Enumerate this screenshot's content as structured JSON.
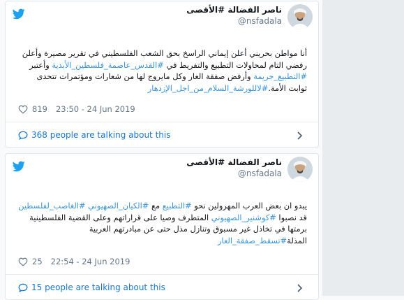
{
  "tweets": [
    {
      "name": "ناصر الفضالة #الأقصى",
      "handle": "@nsfadala",
      "text_parts": [
        {
          "t": "أنا مواطن بحريني أعلن إيماني الراسخ بحق الشعب الفلسطيني في تقرير مصيرة وأعلن رفضي التام لمحاولات التطبيع والتفريط في ",
          "tag": false
        },
        {
          "t": "#القدس_عاصمة_فلسطين_الأبدية",
          "tag": true
        },
        {
          "t": " وأعتبر ",
          "tag": false
        },
        {
          "t": "#التطبيع_جريمة",
          "tag": true
        },
        {
          "t": " وأرفض صفقة العار وكل مايروج لها من شعارات ومؤتمرات تتحدى ثوابت الأمة.",
          "tag": false
        },
        {
          "t": "#لاللورشة_السلام_من_اجل_الإزدهار",
          "tag": true
        }
      ],
      "likes": "819",
      "time": "23:50 - 24 Jun 2019",
      "talking": "368 people are talking about this"
    },
    {
      "name": "ناصر الفضالة #الأقصى",
      "handle": "@nsfadala",
      "text_parts": [
        {
          "t": "يبدو ان بعض العرب المهرولين نحو ",
          "tag": false
        },
        {
          "t": "#التطبيع",
          "tag": true
        },
        {
          "t": " مع ",
          "tag": false
        },
        {
          "t": "#الكيان_الصهيوني",
          "tag": true
        },
        {
          "t": " ",
          "tag": false
        },
        {
          "t": "#الغاصب_لفلسطين",
          "tag": true
        },
        {
          "t": " قد نصبوا ",
          "tag": false
        },
        {
          "t": "#كوشنير_الصهيوني",
          "tag": true
        },
        {
          "t": " المتطرف وصيا على قراراتهم وعلى القضية الفلسطينية برمتها في تخاذل غير مسبوق وتنازل مذل حتى عن مبادرتهم العربية المذلة",
          "tag": false
        },
        {
          "t": "#تسقط_صفقة_العار",
          "tag": true
        }
      ],
      "likes": "25",
      "time": "22:54 - 24 Jun 2019",
      "talking": "15 people are talking about this"
    }
  ],
  "colors": {
    "accent": "#1da1f2",
    "link": "#3b94d9",
    "talk": "#1b74c9"
  }
}
